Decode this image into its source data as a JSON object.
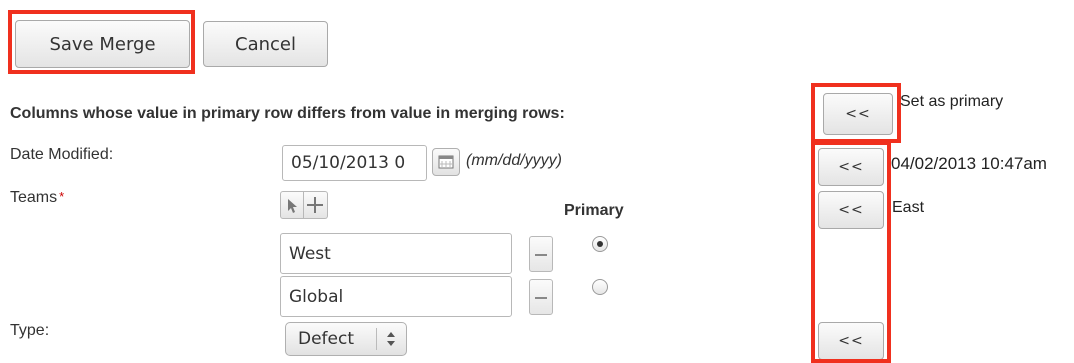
{
  "toolbar": {
    "save_merge_label": "Save Merge",
    "cancel_label": "Cancel"
  },
  "columns_header": "Columns whose value in primary row differs from value in merging rows:",
  "set_as_primary": {
    "button_label": "<<",
    "text": "Set as primary"
  },
  "fields": {
    "date_modified": {
      "label": "Date Modified:",
      "value": "05/10/2013 0",
      "format_hint": "(mm/dd/yyyy)",
      "copy_label": "<<",
      "merge_value": "04/02/2013 10:47am"
    },
    "teams": {
      "label": "Teams",
      "required_marker": "*",
      "primary_header": "Primary",
      "rows": [
        {
          "value": "West",
          "primary": true
        },
        {
          "value": "Global",
          "primary": false
        }
      ],
      "copy_label": "<<",
      "merge_value": "East"
    },
    "type": {
      "label": "Type:",
      "value": "Defect",
      "copy_label": "<<"
    }
  },
  "colors": {
    "highlight": "#f0301e",
    "required": "#cc0000"
  }
}
